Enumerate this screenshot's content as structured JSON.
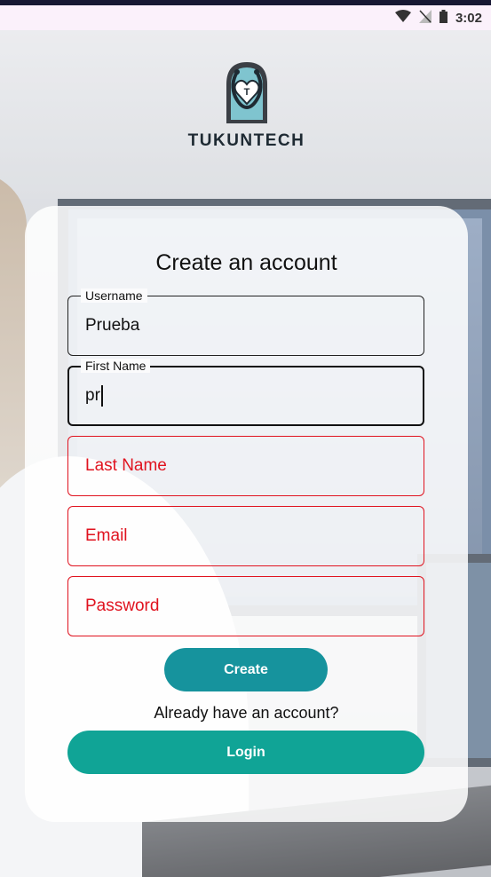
{
  "status_bar": {
    "time": "3:02",
    "icons": [
      "wifi-icon",
      "no-signal-icon",
      "battery-icon"
    ]
  },
  "logo": {
    "brand": "TUKUNTECH",
    "badge_letter": "T"
  },
  "form": {
    "title": "Create an account",
    "fields": [
      {
        "label": "Username",
        "value": "Prueba",
        "state": "filled"
      },
      {
        "label": "First Name",
        "value": "pr",
        "state": "focused"
      },
      {
        "placeholder": "Last Name",
        "state": "error"
      },
      {
        "placeholder": "Email",
        "state": "error"
      },
      {
        "placeholder": "Password",
        "state": "error"
      }
    ],
    "create_label": "Create",
    "already_text": "Already have an account?",
    "login_label": "Login"
  },
  "colors": {
    "create_button": "#16939d",
    "login_button": "#10a496",
    "error": "#e0131f",
    "status_bar_bg": "#fbf1fb"
  }
}
